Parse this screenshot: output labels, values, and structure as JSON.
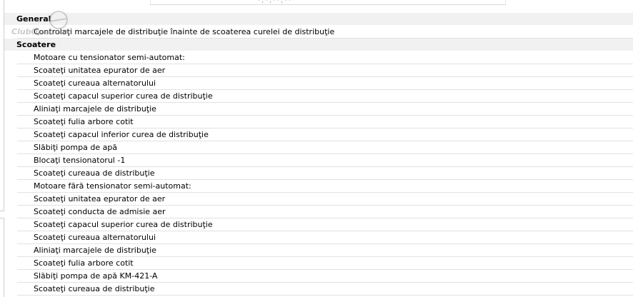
{
  "sections": [
    {
      "title": "General",
      "items": [
        "Controlaţi marcajele de distribuţie înainte de scoaterea curelei de distribuţie"
      ]
    },
    {
      "title": "Scoatere",
      "items": [
        "Motoare cu tensionator semi-automat:",
        "Scoateţi unitatea epurator de aer",
        "Scoateţi cureaua alternatorului",
        "Scoateţi capacul superior curea de distribuţie",
        "Aliniaţi marcajele de distribuţie",
        "Scoateţi fulia arbore cotit",
        "Scoateţi capacul inferior curea de distribuţie",
        "Slăbiţi pompa de apă",
        "Blocaţi tensionatorul -1",
        "Scoateţi cureaua de distribuţie",
        "Motoare fără tensionator semi-automat:",
        "Scoateţi unitatea epurator de aer",
        "Scoateţi conducta de admisie aer",
        "Scoateţi capacul superior curea de distribuţie",
        "Scoateţi cureaua alternatorului",
        "Aliniaţi marcajele de distribuţie",
        "Scoateţi fulia arbore cotit",
        "Slăbiţi pompa de apă KM-421-A",
        "Scoateţi cureaua de distribuţie"
      ]
    }
  ],
  "watermark": {
    "text": "ClubOpel.com"
  },
  "colors": {
    "header_bg": "#f1f1f1",
    "row_divider": "#e2e2e2",
    "text": "#000000"
  }
}
